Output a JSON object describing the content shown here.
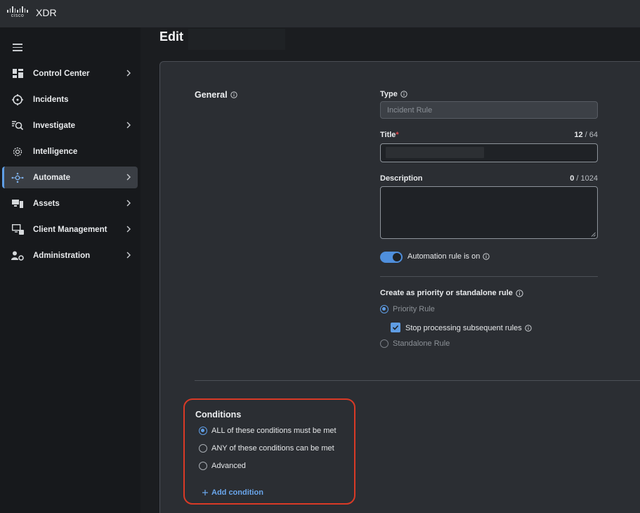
{
  "app": {
    "logo_text": "cisco",
    "title": "XDR"
  },
  "sidebar": {
    "items": [
      {
        "label": "Control Center",
        "icon": "dashboard-icon",
        "chevron": true,
        "active": false
      },
      {
        "label": "Incidents",
        "icon": "crosshair-icon",
        "chevron": false,
        "active": false
      },
      {
        "label": "Investigate",
        "icon": "search-list-icon",
        "chevron": true,
        "active": false
      },
      {
        "label": "Intelligence",
        "icon": "brain-gear-icon",
        "chevron": false,
        "active": false
      },
      {
        "label": "Automate",
        "icon": "workflow-icon",
        "chevron": true,
        "active": true
      },
      {
        "label": "Assets",
        "icon": "devices-icon",
        "chevron": true,
        "active": false
      },
      {
        "label": "Client Management",
        "icon": "client-device-icon",
        "chevron": true,
        "active": false
      },
      {
        "label": "Administration",
        "icon": "user-gear-icon",
        "chevron": true,
        "active": false
      }
    ]
  },
  "page": {
    "title": "Edit"
  },
  "general": {
    "section_label": "General",
    "type": {
      "label": "Type",
      "value": "Incident Rule"
    },
    "title_field": {
      "label": "Title",
      "required_mark": "*",
      "count": "12",
      "max": "/ 64"
    },
    "description": {
      "label": "Description",
      "count": "0",
      "max": "/ 1024",
      "value": ""
    },
    "automation_toggle": {
      "label": "Automation rule is on",
      "on": true
    },
    "priority": {
      "label": "Create as priority or standalone rule",
      "option_priority": "Priority Rule",
      "stop_processing": "Stop processing subsequent rules",
      "option_standalone": "Standalone Rule"
    }
  },
  "conditions": {
    "section_label": "Conditions",
    "options": [
      {
        "label": "ALL of these conditions must be met",
        "checked": true
      },
      {
        "label": "ANY of these conditions can be met",
        "checked": false
      },
      {
        "label": "Advanced",
        "checked": false
      }
    ],
    "add_label": "Add condition"
  },
  "colors": {
    "accent": "#5f9de4",
    "highlight": "#d93a26",
    "required": "#e5484d"
  }
}
